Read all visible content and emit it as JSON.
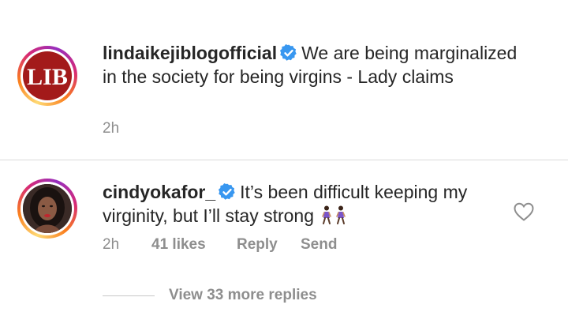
{
  "post": {
    "username": "lindaikejiblogofficial",
    "avatar_text": "LIB",
    "caption": "We are being marginalized in the society for being virgins - Lady claims",
    "time": "2h"
  },
  "comment": {
    "username": "cindyokafor_",
    "text": "It’s been difficult keeping my virginity, but I’ll stay strong",
    "emoji_icons": [
      "woman-walking-icon",
      "woman-walking-icon"
    ],
    "time": "2h",
    "likes": "41 likes",
    "reply_label": "Reply",
    "send_label": "Send"
  },
  "view_replies": "View 33 more replies",
  "colors": {
    "verified": "#3897f0",
    "secondary_text": "#8e8e8e",
    "primary_text": "#262626",
    "lib_red": "#a31a1a"
  }
}
